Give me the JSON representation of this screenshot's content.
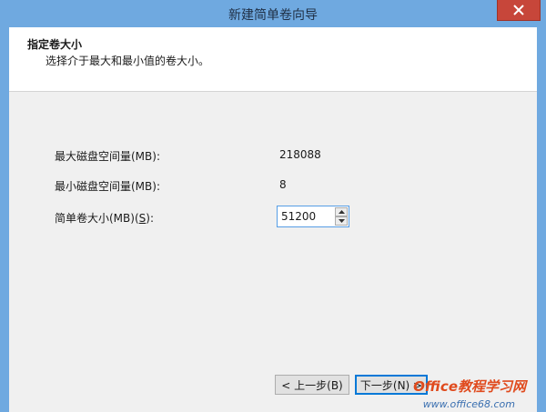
{
  "window": {
    "title": "新建简单卷向导"
  },
  "header": {
    "title": "指定卷大小",
    "subtitle": "选择介于最大和最小值的卷大小。"
  },
  "fields": {
    "max_label": "最大磁盘空间量(MB):",
    "max_value": "218088",
    "min_label": "最小磁盘空间量(MB):",
    "min_value": "8",
    "size_label": "简单卷大小(MB)(S):",
    "size_value": "51200"
  },
  "buttons": {
    "back_label": "< 上一步(B)",
    "next_label": "下一步(N) >"
  },
  "watermark": {
    "brand": "Office教程学习网",
    "url": "www.office68.com"
  },
  "colors": {
    "titlebar": "#6fa9e0",
    "close": "#c7463a",
    "focus_border": "#0078d7"
  }
}
